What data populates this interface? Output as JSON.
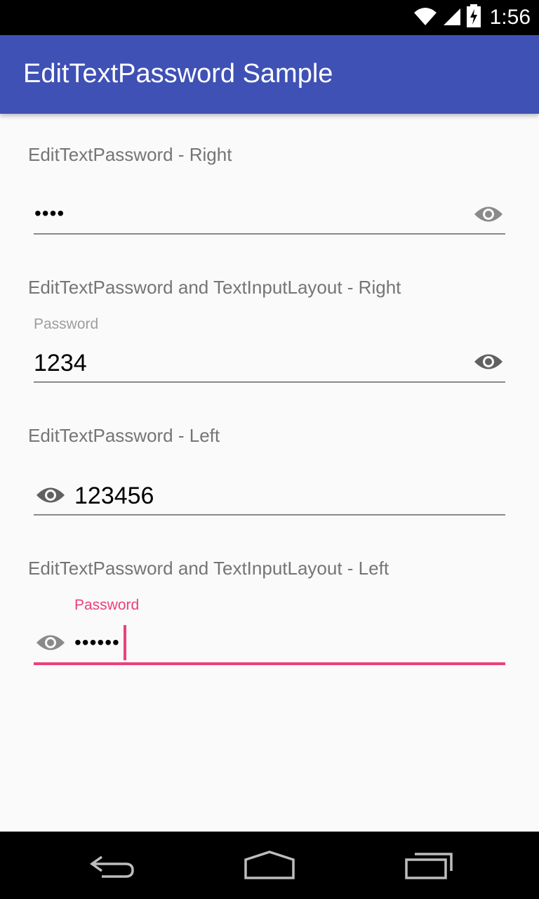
{
  "status_bar": {
    "time": "1:56",
    "icons": [
      "wifi-icon",
      "cell-signal-icon",
      "battery-charging-icon"
    ]
  },
  "app_bar": {
    "title": "EditTextPassword Sample",
    "color": "#3f51b5"
  },
  "sections": [
    {
      "label": "EditTextPassword - Right",
      "value": "••••",
      "masked": true,
      "toggle_icon": "eye-icon",
      "toggle_position": "right"
    },
    {
      "label": "EditTextPassword and TextInputLayout - Right",
      "hint": "Password",
      "value": "1234",
      "masked": false,
      "toggle_icon": "eye-icon",
      "toggle_position": "right"
    },
    {
      "label": "EditTextPassword - Left",
      "value": "123456",
      "masked": false,
      "toggle_icon": "eye-icon",
      "toggle_position": "left"
    },
    {
      "label": "EditTextPassword and TextInputLayout - Left",
      "hint": "Password",
      "value": "••••••",
      "masked": true,
      "focused": true,
      "toggle_icon": "eye-icon",
      "toggle_position": "left"
    }
  ],
  "colors": {
    "accent": "#ec407a",
    "hint_inactive": "#9e9e9e",
    "label": "#757575"
  },
  "nav_bar": {
    "icons": [
      "back-icon",
      "home-icon",
      "recents-icon"
    ]
  }
}
